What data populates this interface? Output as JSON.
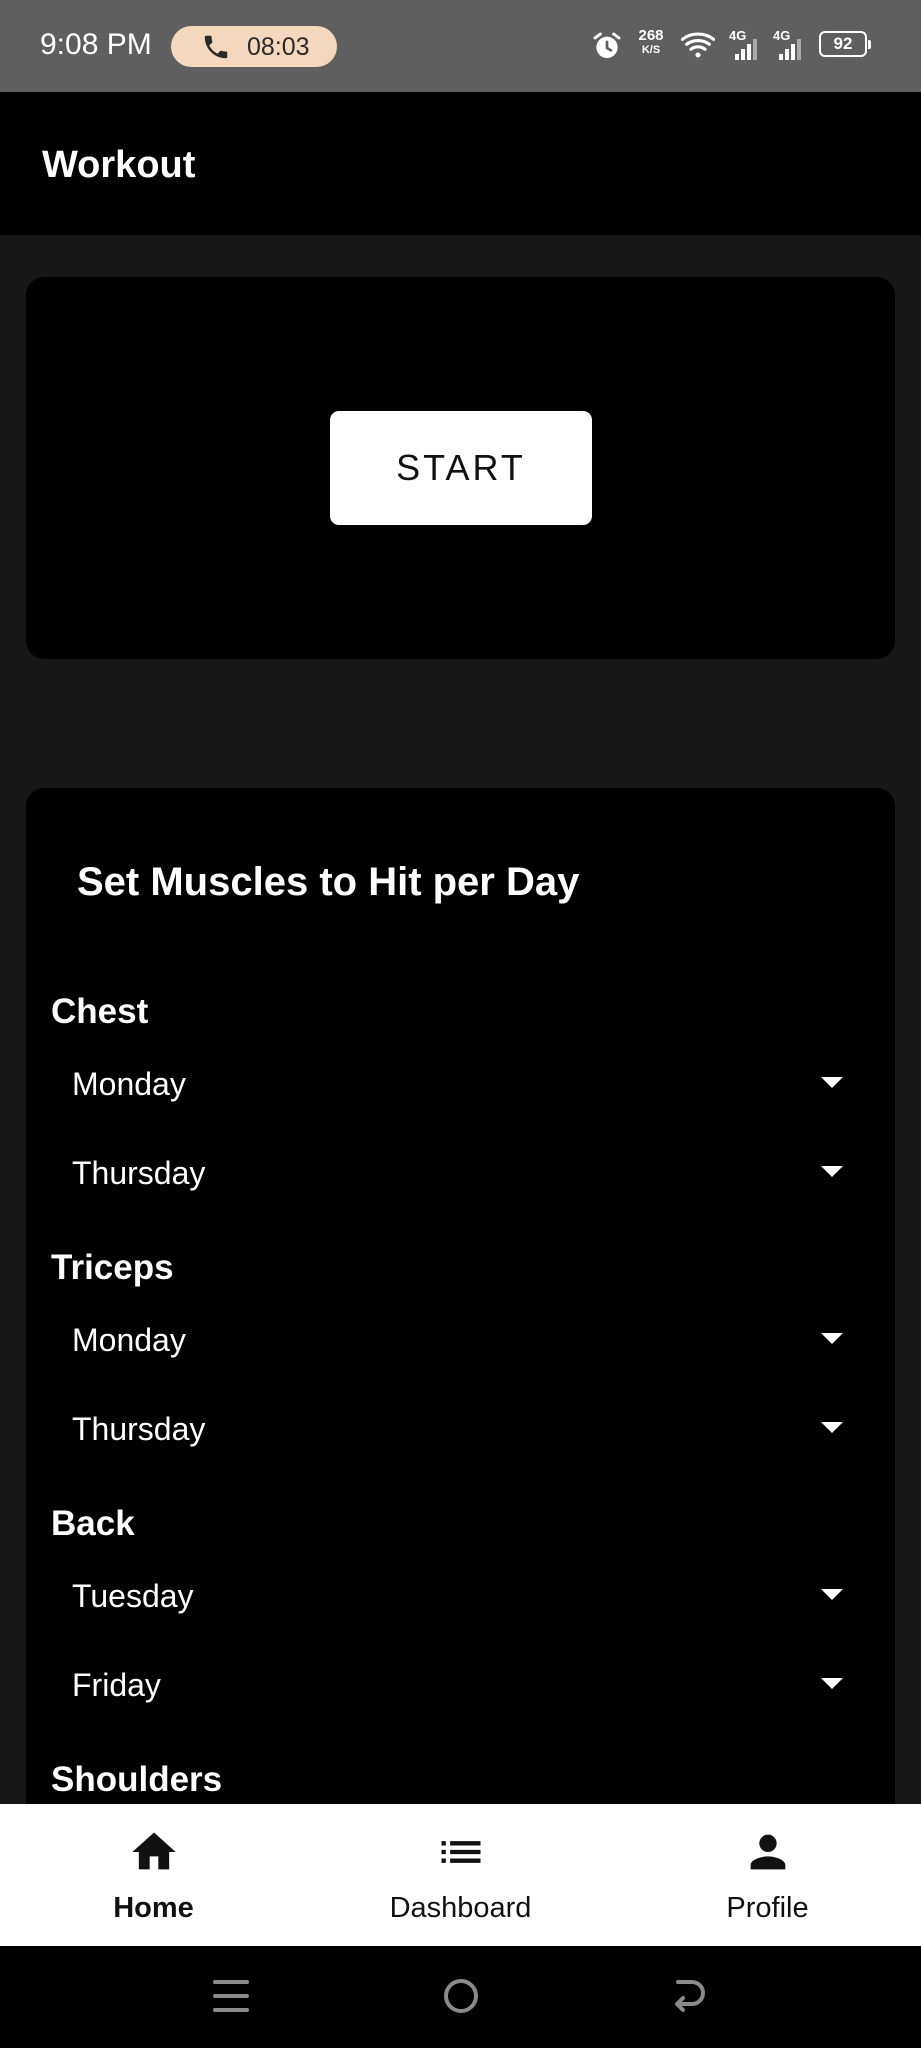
{
  "status_bar": {
    "time": "9:08 PM",
    "call_timer": "08:03",
    "net_speed": "268",
    "net_speed_unit": "K/S",
    "sim1": "4G",
    "sim2": "4G",
    "battery": "92"
  },
  "app_bar": {
    "title": "Workout"
  },
  "start_card": {
    "button_label": "START"
  },
  "muscles": {
    "title": "Set Muscles to Hit per Day",
    "groups": [
      {
        "name": "Chest",
        "days": [
          "Monday",
          "Thursday"
        ]
      },
      {
        "name": "Triceps",
        "days": [
          "Monday",
          "Thursday"
        ]
      },
      {
        "name": "Back",
        "days": [
          "Tuesday",
          "Friday"
        ]
      },
      {
        "name": "Shoulders",
        "days": []
      }
    ]
  },
  "bottom_nav": {
    "items": [
      {
        "label": "Home",
        "icon": "home-icon",
        "active": true
      },
      {
        "label": "Dashboard",
        "icon": "list-icon",
        "active": false
      },
      {
        "label": "Profile",
        "icon": "person-icon",
        "active": false
      }
    ]
  },
  "system_nav": {
    "icons": [
      "menu-icon",
      "home-circle-icon",
      "back-icon"
    ]
  }
}
